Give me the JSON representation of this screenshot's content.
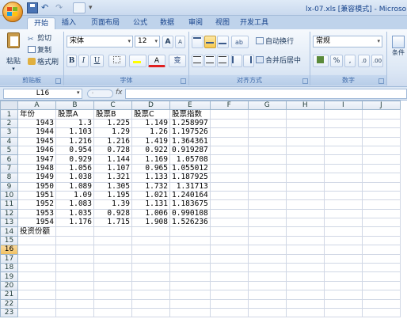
{
  "window": {
    "title": "lx-07.xls [兼容模式] - Microso"
  },
  "tabs": [
    "开始",
    "插入",
    "页面布局",
    "公式",
    "数据",
    "审阅",
    "视图",
    "开发工具"
  ],
  "ribbon": {
    "clipboard": {
      "paste": "粘贴",
      "cut": "剪切",
      "copy": "复制",
      "format_painter": "格式刷",
      "label": "剪贴板"
    },
    "font": {
      "name": "宋体",
      "size": "12",
      "bold": "B",
      "italic": "I",
      "underline": "U",
      "grow": "A",
      "shrink": "A",
      "font_color": "A",
      "phonetic": "变",
      "label": "字体"
    },
    "alignment": {
      "wrap": "自动换行",
      "merge": "合并后居中",
      "label": "对齐方式"
    },
    "number": {
      "format": "常规",
      "percent": "%",
      "comma": ",",
      "label": "数字"
    },
    "styles": {
      "partial": "条件"
    }
  },
  "formula_bar": {
    "name_box": "L16",
    "fx": "fx",
    "value": ""
  },
  "columns": [
    "A",
    "B",
    "C",
    "D",
    "E",
    "F",
    "G",
    "H",
    "I",
    "J"
  ],
  "selected_row": "16",
  "rows": [
    {
      "n": "1",
      "cells": [
        "年份",
        "股票A",
        "股票B",
        "股票C",
        "股票指数"
      ]
    },
    {
      "n": "2",
      "cells": [
        "1943",
        "1.3",
        "1.225",
        "1.149",
        "1.258997"
      ]
    },
    {
      "n": "3",
      "cells": [
        "1944",
        "1.103",
        "1.29",
        "1.26",
        "1.197526"
      ]
    },
    {
      "n": "4",
      "cells": [
        "1945",
        "1.216",
        "1.216",
        "1.419",
        "1.364361"
      ]
    },
    {
      "n": "5",
      "cells": [
        "1946",
        "0.954",
        "0.728",
        "0.922",
        "0.919287"
      ]
    },
    {
      "n": "6",
      "cells": [
        "1947",
        "0.929",
        "1.144",
        "1.169",
        "1.05708"
      ]
    },
    {
      "n": "7",
      "cells": [
        "1948",
        "1.056",
        "1.107",
        "0.965",
        "1.055012"
      ]
    },
    {
      "n": "8",
      "cells": [
        "1949",
        "1.038",
        "1.321",
        "1.133",
        "1.187925"
      ]
    },
    {
      "n": "9",
      "cells": [
        "1950",
        "1.089",
        "1.305",
        "1.732",
        "1.31713"
      ]
    },
    {
      "n": "10",
      "cells": [
        "1951",
        "1.09",
        "1.195",
        "1.021",
        "1.240164"
      ]
    },
    {
      "n": "11",
      "cells": [
        "1952",
        "1.083",
        "1.39",
        "1.131",
        "1.183675"
      ]
    },
    {
      "n": "12",
      "cells": [
        "1953",
        "1.035",
        "0.928",
        "1.006",
        "0.990108"
      ]
    },
    {
      "n": "13",
      "cells": [
        "1954",
        "1.176",
        "1.715",
        "1.908",
        "1.526236"
      ]
    },
    {
      "n": "14",
      "cells": [
        "投资份额",
        "",
        "",
        "",
        ""
      ]
    },
    {
      "n": "15",
      "cells": [
        "",
        "",
        "",
        "",
        ""
      ]
    },
    {
      "n": "16",
      "cells": [
        "",
        "",
        "",
        "",
        ""
      ]
    },
    {
      "n": "17",
      "cells": [
        "",
        "",
        "",
        "",
        ""
      ]
    },
    {
      "n": "18",
      "cells": [
        "",
        "",
        "",
        "",
        ""
      ]
    },
    {
      "n": "19",
      "cells": [
        "",
        "",
        "",
        "",
        ""
      ]
    },
    {
      "n": "20",
      "cells": [
        "",
        "",
        "",
        "",
        ""
      ]
    },
    {
      "n": "21",
      "cells": [
        "",
        "",
        "",
        "",
        ""
      ]
    },
    {
      "n": "22",
      "cells": [
        "",
        "",
        "",
        "",
        ""
      ]
    },
    {
      "n": "23",
      "cells": [
        "",
        "",
        "",
        "",
        ""
      ]
    }
  ]
}
